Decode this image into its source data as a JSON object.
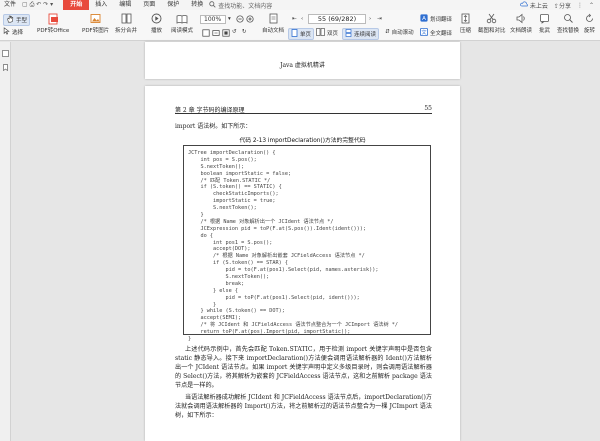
{
  "menubar": {
    "file": "文件",
    "start": "开始",
    "tabs": [
      "插入",
      "编辑",
      "页面",
      "保护",
      "转换"
    ],
    "search_placeholder": "查找功能、文档内容",
    "cloud_label": "未上云",
    "share_label": "分享"
  },
  "toolbar": {
    "hand_label": "手型",
    "select_label": "选择",
    "pdf_to_office": "PDF转Office",
    "pdf_to_image": "PDF转图片",
    "split_merge": "拆分合并",
    "play_label": "播放",
    "read_mode": "阅读模式",
    "zoom_value": "100%",
    "auto_scroll": "自动文档",
    "single_page": "单页",
    "double_page": "双页",
    "continuous_read": "连续阅读",
    "auto_scroll_btn": "自动滚动",
    "page_indicator": "55 (69/282)",
    "translate_word": "划词翻译",
    "full_translate": "全文翻译",
    "compress": "压缩",
    "screenshot_compare": "截图和对比",
    "read_aloud": "文档朗读",
    "bookmark": "批武",
    "find_replace": "查找替换",
    "rotate": "旋转"
  },
  "page1": {
    "running_title": "Java 虚拟机精讲"
  },
  "page2": {
    "chapter_header": "第 2 章    字节码的编译原理",
    "page_number": "55",
    "intro": "import 语法树。如下所示：",
    "caption": "代码 2-13    importDeclaration()方法的完整代码",
    "code_lines": [
      "JCTree importDeclaration() {",
      "    int pos = S.pos();",
      "    S.nextToken();",
      "    boolean importStatic = false;",
      "    /* 匹配 Token.STATIC */",
      "    if (S.token() == STATIC) {",
      "        checkStaticImports();",
      "        importStatic = true;",
      "        S.nextToken();",
      "    }",
      "    /* 根据 Name 对象解析出一个 JCIdent 语法节点 */",
      "    JCExpression pid = toP(F.at(S.pos()).Ident(ident()));",
      "    do {",
      "        int pos1 = S.pos();",
      "        accept(DOT);",
      "        /* 根据 Name 对象解析出嵌套 JCFieldAccess 语法节点 */",
      "        if (S.token() == STAR) {",
      "            pid = to(F.at(pos1).Select(pid, names.asterisk));",
      "            S.nextToken();",
      "            break;",
      "        } else {",
      "            pid = toP(F.at(pos1).Select(pid, ident()));",
      "        }",
      "    } while (S.token() == DOT);",
      "    accept(SEMI);",
      "    /* 将 JCIdent 和 JCFieldAccess 语法节点整合为一个 JCImport 语法树 */",
      "    return toP(F.at(pos).Import(pid, importStatic));",
      "}"
    ],
    "para1": "上述代码示例中，首先会匹配 Token.STATIC，用于检测 import 关键字声明中是否包含 static 静态导入。接下来 importDeclaration()方法便会调用语法解析器的 Ident()方法解析出一个 JCIdent 语法节点。如果 import 关键字声明中定义多级目录时，则会调用语法解析器的 Select()方法，将其解析为嵌套的 JCFieldAccess 语法节点，这和之前解析 package 语法节点是一样的。",
    "para2": "当语法解析器成功解析 JCIdent 和 JCFieldAccess 语法节点后，importDeclaration()方法就会调用语法解析器的 Import()方法，将之前解析过的语法节点整合为一棵 JCImport 语法树，如下所示："
  },
  "colors": {
    "start_tab": "#e84a3c",
    "selected_button": "#dce6f4",
    "accent_blue": "#2f6fd1"
  }
}
